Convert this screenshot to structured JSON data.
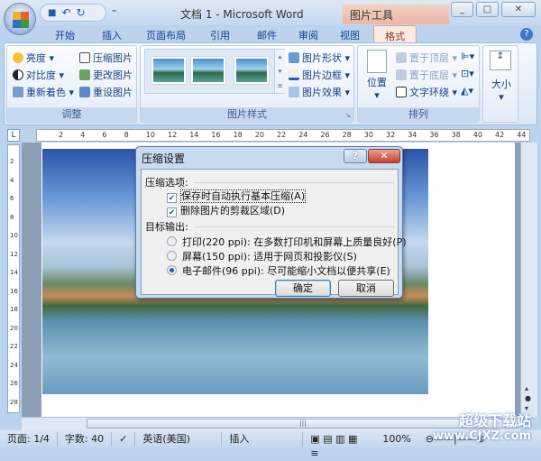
{
  "window": {
    "title": "文档 1 - Microsoft Word",
    "context_tab": "图片工具",
    "minimize": "▭",
    "restore": "⧉",
    "close": "✕"
  },
  "qat": {
    "save": "💾",
    "undo": "↶",
    "redo": "↻",
    "more": "⌄"
  },
  "tabs": [
    "开始",
    "插入",
    "页面布局",
    "引用",
    "邮件",
    "审阅",
    "视图",
    "格式"
  ],
  "active_tab": "格式",
  "help": "?",
  "ribbon": {
    "adjust": {
      "label": "调整",
      "items": [
        "亮度",
        "对比度",
        "重新着色",
        "压缩图片",
        "更改图片",
        "重设图片"
      ]
    },
    "styles": {
      "label": "图片样式",
      "items": [
        "图片形状",
        "图片边框",
        "图片效果"
      ]
    },
    "arrange": {
      "label": "排列",
      "position": "位置",
      "items": [
        "置于顶层",
        "置于底层",
        "文字环绕"
      ]
    },
    "size": {
      "label": "大小"
    }
  },
  "ruler": {
    "corner": "L",
    "marks": [
      "2",
      "4",
      "6",
      "8",
      "10",
      "12",
      "14",
      "16",
      "18",
      "20",
      "22",
      "24",
      "26",
      "28",
      "30",
      "32",
      "34",
      "36",
      "38",
      "40",
      "42",
      "44"
    ],
    "vmarks": [
      "2",
      "4",
      "6",
      "8",
      "10",
      "12",
      "14",
      "16",
      "18",
      "20",
      "22",
      "24",
      "26",
      "28"
    ]
  },
  "dialog": {
    "title": "压缩设置",
    "help": "?",
    "close": "✕",
    "options_header": "压缩选项:",
    "checkboxes": [
      {
        "label": "保存时自动执行基本压缩(A)",
        "checked": true
      },
      {
        "label": "删除图片的剪裁区域(D)",
        "checked": true
      }
    ],
    "target_header": "目标输出:",
    "radios": [
      {
        "label": "打印(220 ppi): 在多数打印机和屏幕上质量良好(P)",
        "selected": false
      },
      {
        "label": "屏幕(150 ppi): 适用于网页和投影仪(S)",
        "selected": false
      },
      {
        "label": "电子邮件(96 ppi): 尽可能缩小文档以便共享(E)",
        "selected": true
      }
    ],
    "ok": "确定",
    "cancel": "取消"
  },
  "status": {
    "page": "页面: 1/4",
    "words": "字数: 40",
    "language": "英语(美国)",
    "mode": "插入",
    "zoom": "100%"
  },
  "watermark": {
    "line1": "超级下载站",
    "line2": "www.CJXZ.com"
  }
}
